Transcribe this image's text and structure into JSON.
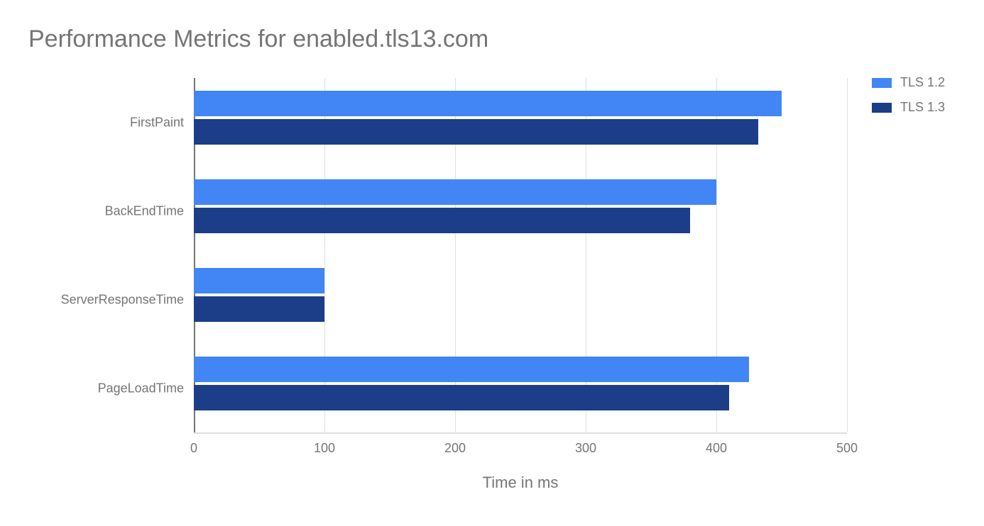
{
  "chart_data": {
    "type": "bar",
    "orientation": "horizontal",
    "title": "Performance Metrics for enabled.tls13.com",
    "xlabel": "Time in ms",
    "ylabel": "",
    "xlim": [
      0,
      500
    ],
    "xticks": [
      0,
      100,
      200,
      300,
      400,
      500
    ],
    "categories": [
      "FirstPaint",
      "BackEndTime",
      "ServerResponseTime",
      "PageLoadTime"
    ],
    "series": [
      {
        "name": "TLS 1.2",
        "color": "#4285f4",
        "values": [
          450,
          400,
          100,
          425
        ]
      },
      {
        "name": "TLS 1.3",
        "color": "#1c3d87",
        "values": [
          432,
          380,
          100,
          410
        ]
      }
    ],
    "legend_position": "right"
  }
}
